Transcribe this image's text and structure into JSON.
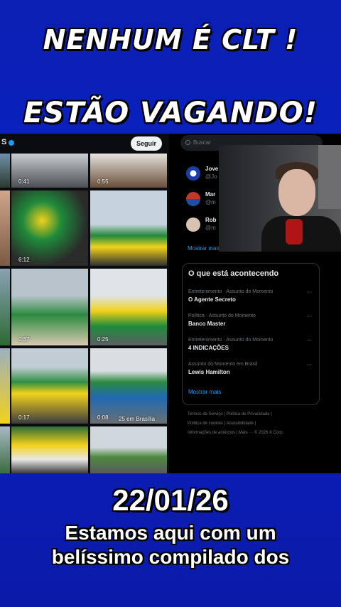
{
  "overlay": {
    "headline1": "NENHUM É CLT !",
    "headline2": "ESTÃO VAGANDO!",
    "date": "22/01/26",
    "subtitle_line1": "Estamos aqui com um",
    "subtitle_line2": "belíssimo compilado dos"
  },
  "feed": {
    "header_initial": "S",
    "follow_label": "Seguir",
    "thumbs": [
      {
        "duration": "0:41"
      },
      {
        "duration": "0:55"
      },
      {
        "duration": "6:12"
      },
      {
        "duration": "0:37"
      },
      {
        "duration": "0:25"
      },
      {
        "duration": "0:17"
      },
      {
        "duration": "0:08",
        "caption": "25 em Brasília"
      }
    ]
  },
  "sidebar": {
    "search_placeholder": "Buscar",
    "who_to_follow": [
      {
        "name": "Jove",
        "handle": "@Jo"
      },
      {
        "name": "Mar",
        "handle": "@m"
      },
      {
        "name": "Rob",
        "handle": "@m"
      }
    ],
    "show_more_1": "Mostrar mais",
    "trends_title": "O que está acontecendo",
    "trends": [
      {
        "context": "Entretenimento · Assunto do Momento",
        "name": "O Agente Secreto"
      },
      {
        "context": "Política · Assunto do Momento",
        "name": "Banco Master"
      },
      {
        "context": "Entretenimento · Assunto do Momento",
        "name": "4 INDICAÇÕES"
      },
      {
        "context": "Assunto do Momento em Brasil",
        "name": "Lewis Hamilton"
      }
    ],
    "show_more_2": "Mostrar mais",
    "footer_line1": "Termos de Serviço  |  Política de Privacidade  |",
    "footer_line2": "Política de cookies  |  Acessibilidade  |",
    "footer_line3": "Informações de anúncios  |  Mais ···  © 2026 X Corp."
  },
  "colors": {
    "background_blue": "#0b1fb3",
    "x_blue": "#1d9bf0",
    "brazil_green": "#1f8a3a",
    "brazil_yellow": "#f2d21b"
  }
}
